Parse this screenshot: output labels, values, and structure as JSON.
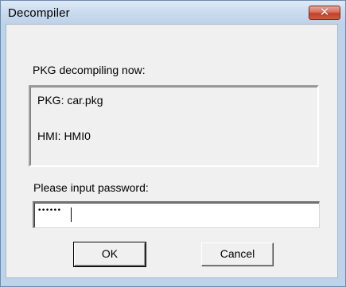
{
  "window": {
    "title": "Decompiler",
    "close_glyph": "✕"
  },
  "dialog": {
    "status_label": "PKG decompiling now:",
    "pkg_line": "PKG:  car.pkg",
    "hmi_line": "HMI:  HMI0",
    "password_label": "Please input password:",
    "password_value": "••••••"
  },
  "buttons": {
    "ok_label": "OK",
    "cancel_label": "Cancel"
  },
  "colors": {
    "titlebar": "#c9dbee",
    "close_button": "#c0412a",
    "dialog_bg": "#f0f0f0"
  }
}
